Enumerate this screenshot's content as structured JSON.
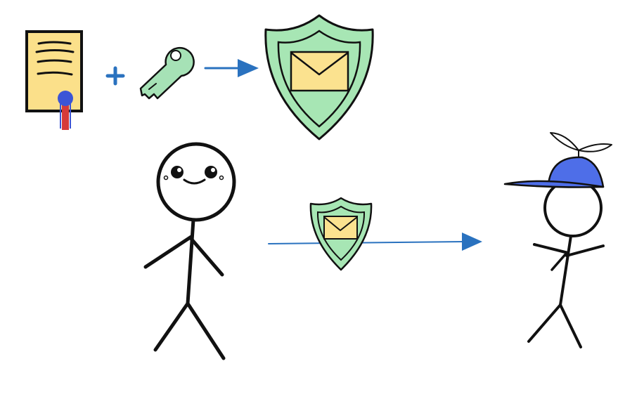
{
  "colors": {
    "ink": "#111111",
    "arrow": "#2a72bf",
    "certificate_paper": "#fbe08a",
    "seal_dot": "#3c55d6",
    "ribbon_red": "#d63a3a",
    "key_fill": "#a6e2b6",
    "shield_fill": "#a7e6b4",
    "envelope": "#fbe28f",
    "cap_blue": "#4e6ee8",
    "propeller": "#ffffff"
  },
  "elements": {
    "certificate": "certificate-icon",
    "plus": "plus-icon",
    "key": "key-icon",
    "shield_large": "shield-envelope-icon",
    "shield_small": "shield-envelope-icon",
    "sender": "stick-figure-smiling",
    "receiver": "stick-figure-propeller-cap"
  }
}
